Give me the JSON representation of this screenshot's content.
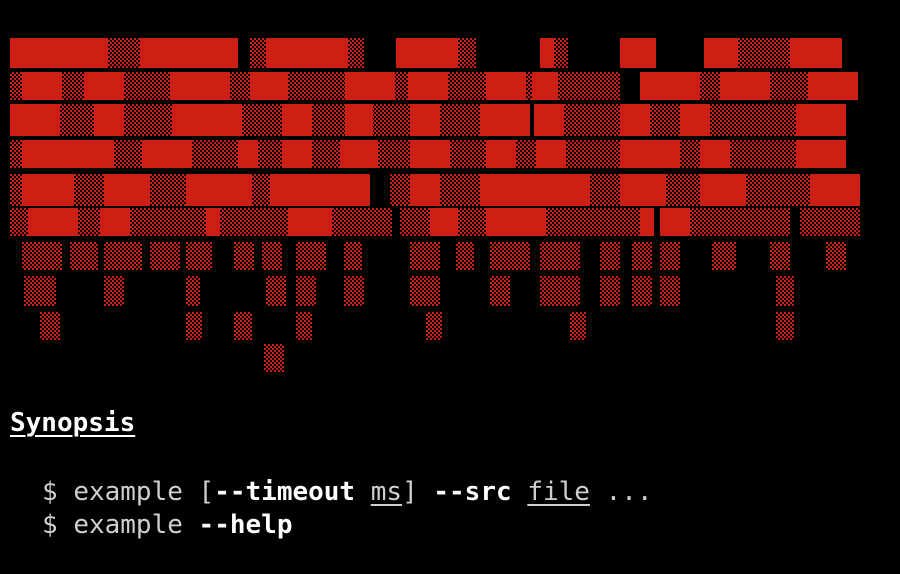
{
  "terminal": {
    "background": "#000000",
    "banner_color": "#cc2015",
    "text_color": "#cfcfcf",
    "emphasis_color": "#ffffff"
  },
  "banner": {
    "text": "REDRUM",
    "style": "dripping-block-ascii-art"
  },
  "section": {
    "heading": "Synopsis"
  },
  "commands": [
    {
      "prompt": "$",
      "name": "example",
      "open_bracket": "[",
      "option": "--timeout",
      "option_arg": "ms",
      "close_bracket": "]",
      "option2": "--src",
      "option2_arg": "file",
      "ellipsis": "..."
    },
    {
      "prompt": "$",
      "name": "example",
      "option": "--help"
    }
  ]
}
